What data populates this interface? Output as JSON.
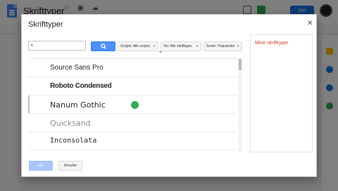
{
  "app": {
    "title": "Skrifttyper",
    "share_label": "Del",
    "accent": "#1a73e8"
  },
  "dialog": {
    "title": "Skrifttyper",
    "close_icon": "close-icon",
    "search": {
      "value": "c",
      "placeholder": "",
      "button_icon": "search-icon"
    },
    "filters": {
      "scripts": "Scripts: Alle scripts",
      "show": "Vis: Alle skrifttyper",
      "sort": "Sortér: Popularitet"
    },
    "fonts": [
      {
        "name": "Source Sans Pro"
      },
      {
        "name": "Roboto Condensed"
      },
      {
        "name": "Nanum Gothic"
      },
      {
        "name": "Quicksand"
      },
      {
        "name": "Inconsolata"
      }
    ],
    "my_fonts_label": "Mine skrifttyper",
    "ok_label": "OK",
    "cancel_label": "Annuller",
    "colors": {
      "primary_button": "#4d90fe",
      "my_fonts_text": "#d23f31",
      "cursor_dot": "#34a853"
    }
  }
}
